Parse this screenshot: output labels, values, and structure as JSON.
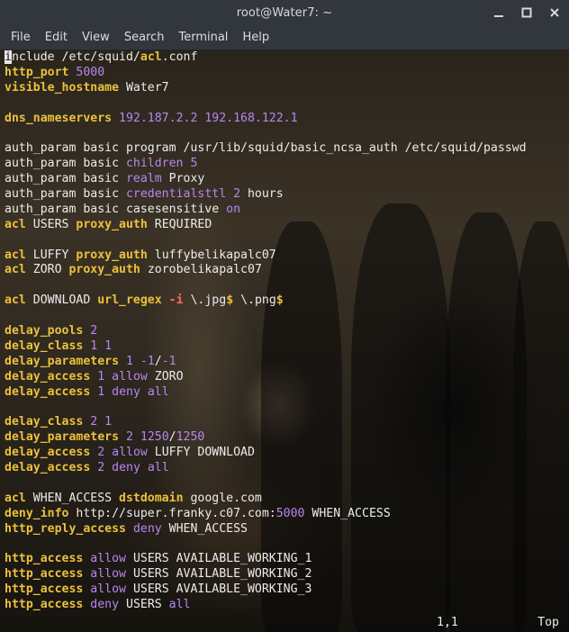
{
  "window": {
    "title": "root@Water7: ~"
  },
  "menu": [
    "File",
    "Edit",
    "View",
    "Search",
    "Terminal",
    "Help"
  ],
  "icons": {
    "minimize": "minimize-icon",
    "maximize": "maximize-icon",
    "close": "close-icon"
  },
  "colors": {
    "keyword": "#ecc13b",
    "number": "#b687f0",
    "option": "#ff6a6a",
    "text": "#ececec",
    "chrome": "#32373d"
  },
  "lines": [
    [
      {
        "t": "i",
        "c": "cursor"
      },
      {
        "t": "nclude /etc/squid/"
      },
      {
        "t": "acl",
        "c": "kw"
      },
      {
        "t": ".conf"
      }
    ],
    [
      {
        "t": "http_port",
        "c": "kw"
      },
      {
        "t": " "
      },
      {
        "t": "5000",
        "c": "num"
      }
    ],
    [
      {
        "t": "visible_hostname",
        "c": "kw"
      },
      {
        "t": " Water7"
      }
    ],
    [],
    [
      {
        "t": "dns_nameservers",
        "c": "kw"
      },
      {
        "t": " "
      },
      {
        "t": "192.187.2.2 192.168.122.1",
        "c": "num"
      }
    ],
    [],
    [
      {
        "t": "auth_param basic program /usr/lib/squid/basic_ncsa_auth /etc/squid/passwd"
      }
    ],
    [
      {
        "t": "auth_param basic "
      },
      {
        "t": "children",
        "c": "num"
      },
      {
        "t": " "
      },
      {
        "t": "5",
        "c": "num"
      }
    ],
    [
      {
        "t": "auth_param basic "
      },
      {
        "t": "realm",
        "c": "num"
      },
      {
        "t": " Proxy"
      }
    ],
    [
      {
        "t": "auth_param basic "
      },
      {
        "t": "credentialsttl",
        "c": "num"
      },
      {
        "t": " "
      },
      {
        "t": "2",
        "c": "num"
      },
      {
        "t": " hours"
      }
    ],
    [
      {
        "t": "auth_param basic casesensitive "
      },
      {
        "t": "on",
        "c": "num"
      }
    ],
    [
      {
        "t": "acl",
        "c": "kw"
      },
      {
        "t": " USERS "
      },
      {
        "t": "proxy_auth",
        "c": "kw"
      },
      {
        "t": " REQUIRED"
      }
    ],
    [],
    [
      {
        "t": "acl",
        "c": "kw"
      },
      {
        "t": " LUFFY "
      },
      {
        "t": "proxy_auth",
        "c": "kw"
      },
      {
        "t": " luffybelikapalc07"
      }
    ],
    [
      {
        "t": "acl",
        "c": "kw"
      },
      {
        "t": " ZORO "
      },
      {
        "t": "proxy_auth",
        "c": "kw"
      },
      {
        "t": " zorobelikapalc07"
      }
    ],
    [],
    [
      {
        "t": "acl",
        "c": "kw"
      },
      {
        "t": " DOWNLOAD "
      },
      {
        "t": "url_regex",
        "c": "kw"
      },
      {
        "t": " "
      },
      {
        "t": "-i",
        "c": "str"
      },
      {
        "t": " \\.jpg"
      },
      {
        "t": "$",
        "c": "rx"
      },
      {
        "t": " \\.png"
      },
      {
        "t": "$",
        "c": "rx"
      }
    ],
    [],
    [
      {
        "t": "delay_pools",
        "c": "kw"
      },
      {
        "t": " "
      },
      {
        "t": "2",
        "c": "num"
      }
    ],
    [
      {
        "t": "delay_class",
        "c": "kw"
      },
      {
        "t": " "
      },
      {
        "t": "1 1",
        "c": "num"
      }
    ],
    [
      {
        "t": "delay_parameters",
        "c": "kw"
      },
      {
        "t": " "
      },
      {
        "t": "1 -1",
        "c": "num"
      },
      {
        "t": "/"
      },
      {
        "t": "-1",
        "c": "num"
      }
    ],
    [
      {
        "t": "delay_access",
        "c": "kw"
      },
      {
        "t": " "
      },
      {
        "t": "1",
        "c": "num"
      },
      {
        "t": " "
      },
      {
        "t": "allow",
        "c": "num"
      },
      {
        "t": " ZORO"
      }
    ],
    [
      {
        "t": "delay_access",
        "c": "kw"
      },
      {
        "t": " "
      },
      {
        "t": "1",
        "c": "num"
      },
      {
        "t": " "
      },
      {
        "t": "deny all",
        "c": "num"
      }
    ],
    [],
    [
      {
        "t": "delay_class",
        "c": "kw"
      },
      {
        "t": " "
      },
      {
        "t": "2 1",
        "c": "num"
      }
    ],
    [
      {
        "t": "delay_parameters",
        "c": "kw"
      },
      {
        "t": " "
      },
      {
        "t": "2 1250",
        "c": "num"
      },
      {
        "t": "/"
      },
      {
        "t": "1250",
        "c": "num"
      }
    ],
    [
      {
        "t": "delay_access",
        "c": "kw"
      },
      {
        "t": " "
      },
      {
        "t": "2",
        "c": "num"
      },
      {
        "t": " "
      },
      {
        "t": "allow",
        "c": "num"
      },
      {
        "t": " LUFFY DOWNLOAD"
      }
    ],
    [
      {
        "t": "delay_access",
        "c": "kw"
      },
      {
        "t": " "
      },
      {
        "t": "2",
        "c": "num"
      },
      {
        "t": " "
      },
      {
        "t": "deny all",
        "c": "num"
      }
    ],
    [],
    [
      {
        "t": "acl",
        "c": "kw"
      },
      {
        "t": " WHEN_ACCESS "
      },
      {
        "t": "dstdomain",
        "c": "kw"
      },
      {
        "t": " google.com"
      }
    ],
    [
      {
        "t": "deny_info",
        "c": "kw"
      },
      {
        "t": " http://super.franky.c07.com:"
      },
      {
        "t": "5000",
        "c": "num"
      },
      {
        "t": " WHEN_ACCESS"
      }
    ],
    [
      {
        "t": "http_reply_access",
        "c": "kw"
      },
      {
        "t": " "
      },
      {
        "t": "deny",
        "c": "num"
      },
      {
        "t": " WHEN_ACCESS"
      }
    ],
    [],
    [
      {
        "t": "http_access",
        "c": "kw"
      },
      {
        "t": " "
      },
      {
        "t": "allow",
        "c": "num"
      },
      {
        "t": " USERS AVAILABLE_WORKING_1"
      }
    ],
    [
      {
        "t": "http_access",
        "c": "kw"
      },
      {
        "t": " "
      },
      {
        "t": "allow",
        "c": "num"
      },
      {
        "t": " USERS AVAILABLE_WORKING_2"
      }
    ],
    [
      {
        "t": "http_access",
        "c": "kw"
      },
      {
        "t": " "
      },
      {
        "t": "allow",
        "c": "num"
      },
      {
        "t": " USERS AVAILABLE_WORKING_3"
      }
    ],
    [
      {
        "t": "http_access",
        "c": "kw"
      },
      {
        "t": " "
      },
      {
        "t": "deny",
        "c": "num"
      },
      {
        "t": " USERS "
      },
      {
        "t": "all",
        "c": "num"
      }
    ]
  ],
  "status": {
    "position": "1,1",
    "scroll": "Top"
  }
}
